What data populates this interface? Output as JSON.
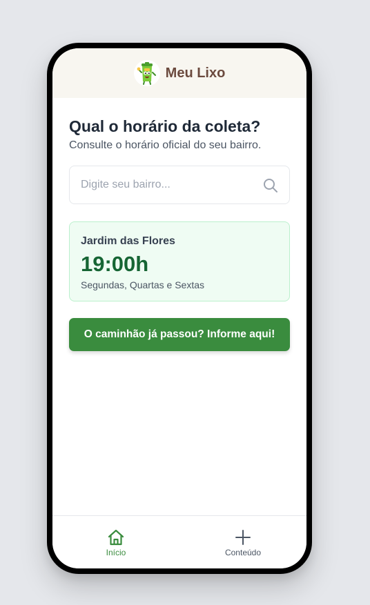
{
  "header": {
    "app_name": "Meu Lixo",
    "logo_icon": "trash-can-mascot-icon"
  },
  "main": {
    "title": "Qual o horário da coleta?",
    "subtitle": "Consulte o horário oficial do seu bairro.",
    "search": {
      "placeholder": "Digite seu bairro...",
      "value": "",
      "icon": "search-icon"
    },
    "schedule_card": {
      "neighborhood": "Jardim das Flores",
      "time": "19:00h",
      "days": "Segundas, Quartas e Sextas"
    },
    "report_button_label": "O caminhão já passou? Informe aqui!"
  },
  "nav": {
    "items": [
      {
        "label": "Início",
        "icon": "home-icon",
        "active": true
      },
      {
        "label": "Conteúdo",
        "icon": "plus-icon",
        "active": false
      }
    ]
  },
  "colors": {
    "brand_green": "#3a8c3e",
    "time_green": "#166534",
    "card_bg": "#effcf3",
    "title_brown": "#6b4a3e",
    "header_bg": "#f8f6f0"
  }
}
